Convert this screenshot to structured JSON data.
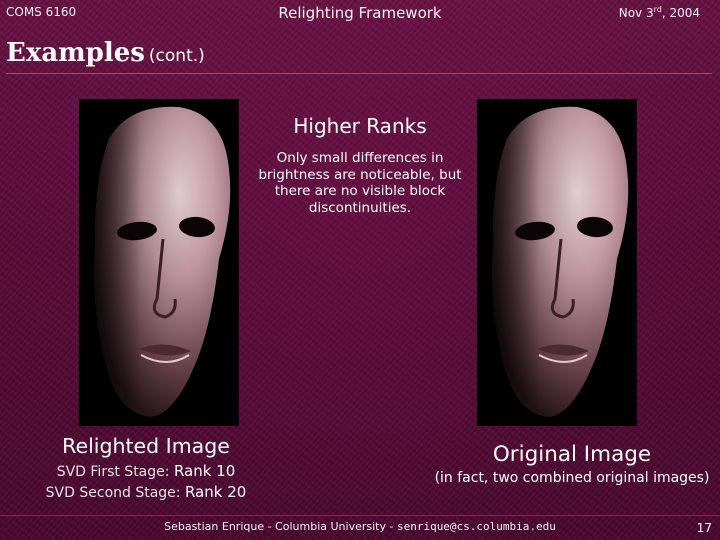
{
  "header": {
    "course": "COMS 6160",
    "topic": "Relighting Framework",
    "date_prefix": "Nov 3",
    "date_sup": "rd",
    "date_suffix": ", 2004"
  },
  "title": {
    "main": "Examples",
    "sub": "(cont.)"
  },
  "caption": {
    "heading": "Higher Ranks",
    "body": "Only small differences in brightness are noticeable, but there are no visible block discontinuities."
  },
  "left_panel": {
    "label": "Relighted Image",
    "stage1_name": "SVD First Stage: ",
    "stage1_rank": "Rank 10",
    "stage2_name": "SVD Second Stage: ",
    "stage2_rank": "Rank 20"
  },
  "right_panel": {
    "label": "Original Image",
    "note": "(in fact, two combined original images)"
  },
  "footer": {
    "text": "Sebastian Enrique - Columbia University - ",
    "email": "senrique@cs.columbia.edu",
    "page": "17"
  },
  "colors": {
    "background": "#5a0b38",
    "rule": "#b3446a",
    "face_skin": "#caa0ab"
  }
}
